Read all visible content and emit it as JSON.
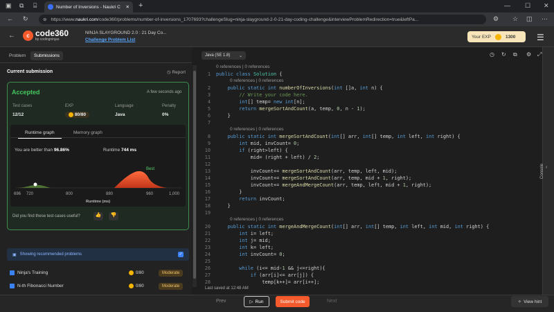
{
  "browser": {
    "tab_title": "Number of Inversions - Naukri C",
    "url_prefix": "https://www.",
    "url_domain": "naukri.com",
    "url_rest": "/code360/problems/number-of-inversions_1707693?challengeSlug=ninja-slayground-2-0-21-day-coding-challenge&interviewProblemRedirection=true&leftPa..."
  },
  "header": {
    "logo_text": "code360",
    "logo_sub": "by codingninjas",
    "challenge_title": "NINJA SLAYGROUND 2.0 : 21 Day Co...",
    "challenge_link": "Challenge Problem List",
    "exp_label": "Your EXP",
    "exp_value": "1300"
  },
  "left": {
    "tabs": [
      "Problem",
      "Submissions"
    ],
    "current_title": "Current submission",
    "report": "Report",
    "status": "Accepted",
    "time_ago": "A few seconds ago",
    "stats": [
      {
        "key": "Test cases",
        "value": "12/12"
      },
      {
        "key": "EXP",
        "value": "80/80"
      },
      {
        "key": "Language",
        "value": "Java"
      },
      {
        "key": "Penalty",
        "value": "0%"
      }
    ],
    "graph_tabs": [
      "Runtime graph",
      "Memory graph"
    ],
    "better_label": "You are better than",
    "better_value": "96.86%",
    "runtime_label": "Runtime",
    "runtime_value": "744 ms",
    "best_label": "Best",
    "x_ticks": [
      "696",
      "720",
      "800",
      "880",
      "960",
      "1,000"
    ],
    "x_axis_label": "Runtime (ms)",
    "feedback_q": "Did you find these test cases useful?",
    "recommended": "Showing recommended problems",
    "problems": [
      {
        "name": "Ninja's Training",
        "exp": "0/80",
        "difficulty": "Moderate"
      },
      {
        "name": "N-th Fibonacci Number",
        "exp": "0/80",
        "difficulty": "Moderate"
      }
    ]
  },
  "editor": {
    "language": "Java (SE 1.8)",
    "last_saved": "Last saved at 12:48 AM"
  },
  "console_label": "Console",
  "bottom": {
    "prev": "Prev",
    "run": "Run",
    "submit": "Submit code",
    "next": "Next",
    "hint": "View hint"
  }
}
